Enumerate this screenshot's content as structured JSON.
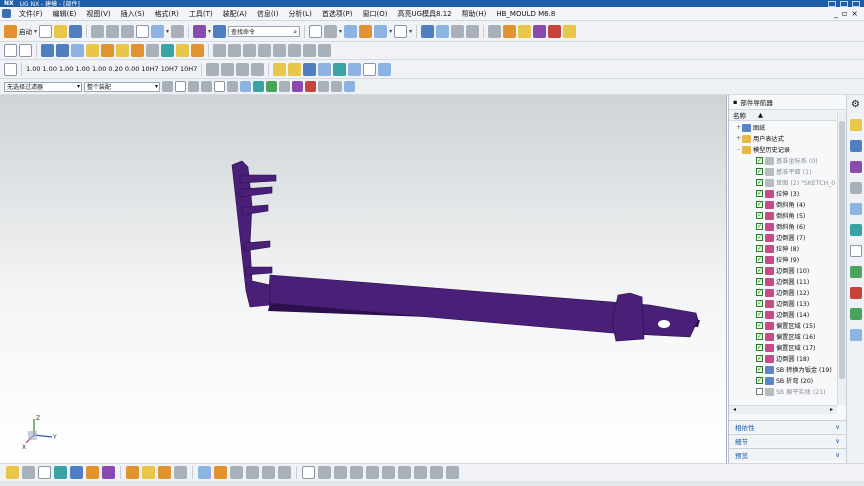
{
  "titlebar": {
    "brand": "NX",
    "title": "UG NX - 建模 - [部件]"
  },
  "menu": {
    "items": [
      "文件(F)",
      "编辑(E)",
      "视图(V)",
      "插入(S)",
      "格式(R)",
      "工具(T)",
      "装配(A)",
      "信息(I)",
      "分析(L)",
      "首选项(P)",
      "窗口(O)",
      "高亮UG模具8.12",
      "帮助(H)",
      "HB_MOULD M6.8"
    ]
  },
  "toolbar1": {
    "start_label": "启动",
    "search_placeholder": "查找命令"
  },
  "toolbar3": {
    "tol_labels": [
      "1.00",
      "1.00",
      "1.00",
      "1.00",
      "1.00",
      "0.20",
      "0.00",
      "10H7",
      "10H7",
      "10H7"
    ]
  },
  "selection": {
    "filter_value": "无选择过滤器",
    "scope_value": "整个装配"
  },
  "navigator": {
    "title": "部件导航器",
    "col_name": "名称",
    "items": [
      {
        "label": "图纸",
        "indent": 1,
        "exp": "+",
        "chk": "",
        "icon": "blue",
        "dim": false
      },
      {
        "label": "用户表达式",
        "indent": 1,
        "exp": "+",
        "chk": "",
        "icon": "folder",
        "dim": false
      },
      {
        "label": "模型历史记录",
        "indent": 1,
        "exp": "-",
        "chk": "",
        "icon": "folder",
        "dim": false
      },
      {
        "label": "基准坐标系 (0)",
        "indent": 2,
        "exp": "",
        "chk": "on",
        "icon": "gray",
        "dim": true
      },
      {
        "label": "基准平面 (1)",
        "indent": 2,
        "exp": "",
        "chk": "on",
        "icon": "gray",
        "dim": true
      },
      {
        "label": "草图 (2) \"SKETCH_0",
        "indent": 2,
        "exp": "",
        "chk": "on",
        "icon": "gray",
        "dim": true
      },
      {
        "label": "拉伸 (3)",
        "indent": 2,
        "exp": "",
        "chk": "on",
        "icon": "feat",
        "dim": false
      },
      {
        "label": "倒斜角 (4)",
        "indent": 2,
        "exp": "",
        "chk": "on",
        "icon": "feat",
        "dim": false
      },
      {
        "label": "倒斜角 (5)",
        "indent": 2,
        "exp": "",
        "chk": "on",
        "icon": "feat",
        "dim": false
      },
      {
        "label": "倒斜角 (6)",
        "indent": 2,
        "exp": "",
        "chk": "on",
        "icon": "feat",
        "dim": false
      },
      {
        "label": "边倒圆 (7)",
        "indent": 2,
        "exp": "",
        "chk": "on",
        "icon": "feat",
        "dim": false
      },
      {
        "label": "拉伸 (8)",
        "indent": 2,
        "exp": "",
        "chk": "on",
        "icon": "feat",
        "dim": false
      },
      {
        "label": "拉伸 (9)",
        "indent": 2,
        "exp": "",
        "chk": "on",
        "icon": "feat",
        "dim": false
      },
      {
        "label": "边倒圆 (10)",
        "indent": 2,
        "exp": "",
        "chk": "on",
        "icon": "feat",
        "dim": false
      },
      {
        "label": "边倒圆 (11)",
        "indent": 2,
        "exp": "",
        "chk": "on",
        "icon": "feat",
        "dim": false
      },
      {
        "label": "边倒圆 (12)",
        "indent": 2,
        "exp": "",
        "chk": "on",
        "icon": "feat",
        "dim": false
      },
      {
        "label": "边倒圆 (13)",
        "indent": 2,
        "exp": "",
        "chk": "on",
        "icon": "feat",
        "dim": false
      },
      {
        "label": "边倒圆 (14)",
        "indent": 2,
        "exp": "",
        "chk": "on",
        "icon": "feat",
        "dim": false
      },
      {
        "label": "偏置区域 (15)",
        "indent": 2,
        "exp": "",
        "chk": "on",
        "icon": "feat",
        "dim": false
      },
      {
        "label": "偏置区域 (16)",
        "indent": 2,
        "exp": "",
        "chk": "on",
        "icon": "feat",
        "dim": false
      },
      {
        "label": "偏置区域 (17)",
        "indent": 2,
        "exp": "",
        "chk": "on",
        "icon": "feat",
        "dim": false
      },
      {
        "label": "边倒圆 (18)",
        "indent": 2,
        "exp": "",
        "chk": "on",
        "icon": "feat",
        "dim": false
      },
      {
        "label": "SB 转换为钣金 (19)",
        "indent": 2,
        "exp": "",
        "chk": "on",
        "icon": "blue",
        "dim": false
      },
      {
        "label": "SB 折弯 (20)",
        "indent": 2,
        "exp": "",
        "chk": "on",
        "icon": "blue",
        "dim": false
      },
      {
        "label": "SB 展平实体 (21)",
        "indent": 2,
        "exp": "",
        "chk": "off",
        "icon": "gray",
        "dim": true
      }
    ],
    "sections": [
      "相依性",
      "细节",
      "预览"
    ]
  },
  "triad": {
    "x": "X",
    "y": "Y",
    "z": "Z"
  },
  "colors": {
    "part": "#4a1f78",
    "part_dark": "#2c0f4d",
    "accent": "#1c57a6"
  }
}
